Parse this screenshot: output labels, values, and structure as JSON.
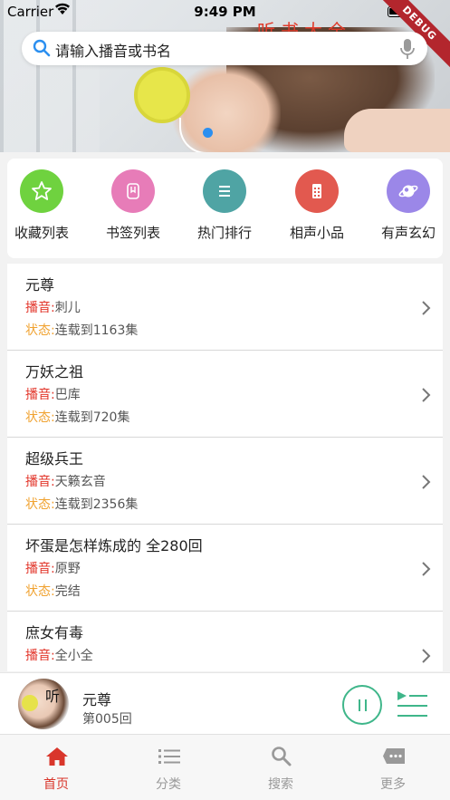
{
  "status_bar": {
    "carrier": "Carrier",
    "time": "9:49 PM"
  },
  "debug_banner": "DEBUG",
  "banner": {
    "title": "听书大全",
    "active_dot_color": "#2b8ff0"
  },
  "search": {
    "placeholder": "请输入播音或书名"
  },
  "quick_actions": [
    {
      "label": "收藏列表",
      "color": "#6fd23f",
      "icon": "star-icon"
    },
    {
      "label": "书签列表",
      "color": "#e77cb8",
      "icon": "bookmark-icon"
    },
    {
      "label": "热门排行",
      "color": "#4fa4a4",
      "icon": "list-icon"
    },
    {
      "label": "相声小品",
      "color": "#e2594f",
      "icon": "document-icon"
    },
    {
      "label": "有声玄幻",
      "color": "#9b87e8",
      "icon": "planet-icon"
    }
  ],
  "list_keys": {
    "host": "播音:",
    "state": "状态:"
  },
  "books": [
    {
      "title": "元尊",
      "host": "刺儿",
      "state": "连载到1163集"
    },
    {
      "title": "万妖之祖",
      "host": "巴库",
      "state": "连载到720集"
    },
    {
      "title": "超级兵王",
      "host": "天籁玄音",
      "state": "连载到2356集"
    },
    {
      "title": "坏蛋是怎样炼成的 全280回",
      "host": "原野",
      "state": "完结"
    },
    {
      "title": "庶女有毒",
      "host": "全小全",
      "state": ""
    }
  ],
  "player": {
    "cover_char": "听",
    "title": "元尊",
    "episode": "第005回",
    "accent": "#3fb68a"
  },
  "tabs": [
    {
      "label": "首页",
      "icon": "home-icon",
      "active": true
    },
    {
      "label": "分类",
      "icon": "list-icon",
      "active": false
    },
    {
      "label": "搜索",
      "icon": "search-icon",
      "active": false
    },
    {
      "label": "更多",
      "icon": "more-icon",
      "active": false
    }
  ],
  "colors": {
    "active_tab": "#d9362b",
    "inactive_tab": "#999999",
    "host_key": "#e2352a",
    "state_key": "#f0a230"
  }
}
